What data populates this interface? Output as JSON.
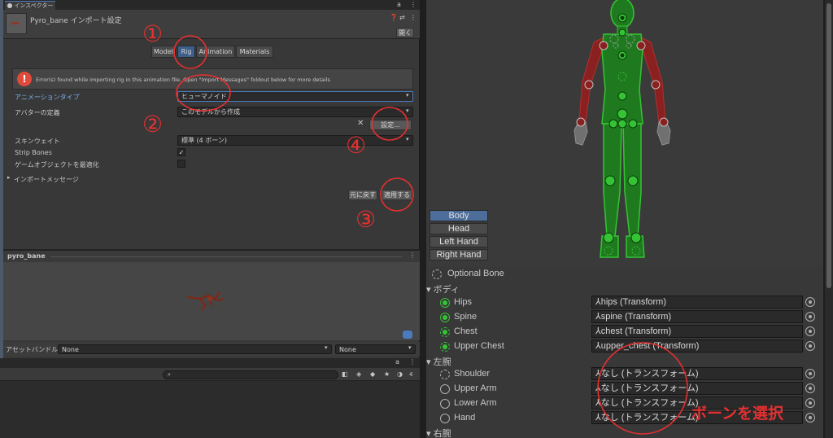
{
  "inspector": {
    "tab_label": "インスペクター",
    "title": "Pyro_bane インポート設定",
    "open_button": "開く",
    "tabs": [
      "Model",
      "Rig",
      "Animation",
      "Materials"
    ],
    "error_message": "Error(s) found while importing rig in this animation file. Open \"Import Messages\" foldout below for more details",
    "animation_type_label": "アニメーションタイプ",
    "animation_type_value": "ヒューマノイド",
    "avatar_def_label": "アバターの定義",
    "avatar_def_value": "このモデルから作成",
    "configure_button": "設定...",
    "skin_weights_label": "スキンウェイト",
    "skin_weights_value": "標準 (4 ボーン)",
    "strip_bones_label": "Strip Bones",
    "optimize_label": "ゲームオブジェクトを最適化",
    "import_messages_label": "インポートメッセージ",
    "revert_button": "元に戻す",
    "apply_button": "適用する"
  },
  "preview": {
    "title": "pyro_bane"
  },
  "asset_bundle": {
    "label": "アセットバンドル",
    "value1": "None",
    "value2": "None"
  },
  "bottom_toolbar": {
    "count": "4"
  },
  "annotations": {
    "n1": "①",
    "n2": "②",
    "n3": "③",
    "n4": "④",
    "select_bone": "ボーンを選択"
  },
  "avatar": {
    "body_buttons": [
      "Body",
      "Head",
      "Left Hand",
      "Right Hand"
    ],
    "optional_bone": "Optional Bone",
    "sections": [
      "ボディ",
      "左腕",
      "右腕"
    ],
    "body_rows": [
      {
        "label": "Hips",
        "value": "hips (Transform)"
      },
      {
        "label": "Spine",
        "value": "spine (Transform)"
      },
      {
        "label": "Chest",
        "value": "chest (Transform)"
      },
      {
        "label": "Upper Chest",
        "value": "upper_chest (Transform)"
      }
    ],
    "left_arm_rows": [
      {
        "label": "Shoulder",
        "value": "なし (トランスフォーム)"
      },
      {
        "label": "Upper Arm",
        "value": "なし (トランスフォーム)"
      },
      {
        "label": "Lower Arm",
        "value": "なし (トランスフォーム)"
      },
      {
        "label": "Hand",
        "value": "なし (トランスフォーム)"
      }
    ]
  },
  "colors": {
    "accent_red": "#e53030",
    "bone_green": "#35c335",
    "panel_bg": "#383838"
  }
}
